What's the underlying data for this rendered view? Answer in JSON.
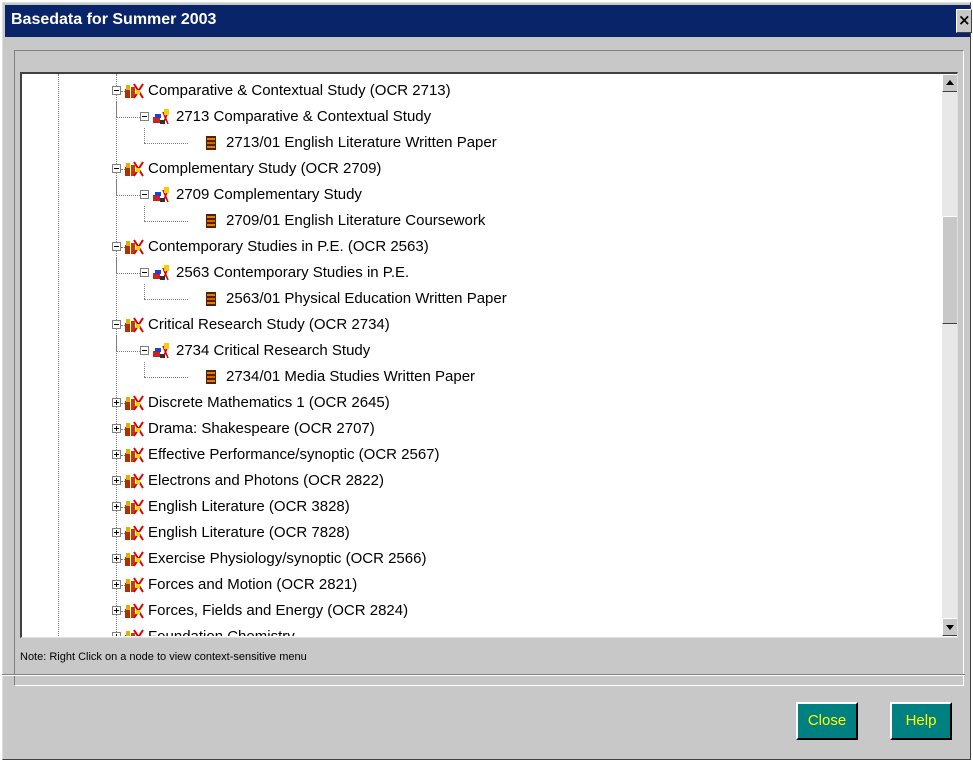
{
  "window": {
    "title": "Basedata for Summer 2003",
    "close_glyph": "×"
  },
  "tree": {
    "rows": [
      {
        "label": "Comparative & Contextual Study (OCR 2713)",
        "level": 0,
        "icon": "subject-icon",
        "expander": "minus"
      },
      {
        "label": "2713 Comparative & Contextual Study",
        "level": 1,
        "icon": "unit-icon",
        "expander": "minus"
      },
      {
        "label": "2713/01 English Literature Written Paper",
        "level": 2,
        "icon": "component-icon",
        "expander": "none"
      },
      {
        "label": "Complementary Study (OCR 2709)",
        "level": 0,
        "icon": "subject-icon",
        "expander": "minus"
      },
      {
        "label": "2709 Complementary Study",
        "level": 1,
        "icon": "unit-icon",
        "expander": "minus"
      },
      {
        "label": "2709/01 English Literature Coursework",
        "level": 2,
        "icon": "component-icon",
        "expander": "none"
      },
      {
        "label": "Contemporary Studies in P.E.  (OCR 2563)",
        "level": 0,
        "icon": "subject-icon",
        "expander": "minus"
      },
      {
        "label": "2563 Contemporary Studies in P.E.",
        "level": 1,
        "icon": "unit-icon",
        "expander": "minus"
      },
      {
        "label": "2563/01 Physical Education Written Paper",
        "level": 2,
        "icon": "component-icon",
        "expander": "none"
      },
      {
        "label": "Critical Research Study (OCR 2734)",
        "level": 0,
        "icon": "subject-icon",
        "expander": "minus"
      },
      {
        "label": "2734 Critical Research Study",
        "level": 1,
        "icon": "unit-icon",
        "expander": "minus"
      },
      {
        "label": "2734/01 Media Studies Written Paper",
        "level": 2,
        "icon": "component-icon",
        "expander": "none"
      },
      {
        "label": "Discrete Mathematics 1 (OCR 2645)",
        "level": 0,
        "icon": "subject-icon",
        "expander": "plus"
      },
      {
        "label": "Drama:  Shakespeare (OCR 2707)",
        "level": 0,
        "icon": "subject-icon",
        "expander": "plus"
      },
      {
        "label": "Effective Performance/synoptic (OCR 2567)",
        "level": 0,
        "icon": "subject-icon",
        "expander": "plus"
      },
      {
        "label": "Electrons and Photons (OCR 2822)",
        "level": 0,
        "icon": "subject-icon",
        "expander": "plus"
      },
      {
        "label": "English Literature (OCR 3828)",
        "level": 0,
        "icon": "subject-icon",
        "expander": "plus"
      },
      {
        "label": "English Literature (OCR 7828)",
        "level": 0,
        "icon": "subject-icon",
        "expander": "plus"
      },
      {
        "label": "Exercise Physiology/synoptic (OCR 2566)",
        "level": 0,
        "icon": "subject-icon",
        "expander": "plus"
      },
      {
        "label": "Forces and Motion (OCR 2821)",
        "level": 0,
        "icon": "subject-icon",
        "expander": "plus"
      },
      {
        "label": "Forces,  Fields and Energy (OCR 2824)",
        "level": 0,
        "icon": "subject-icon",
        "expander": "plus"
      },
      {
        "label": "Foundation Chemistry",
        "level": 0,
        "icon": "subject-icon",
        "expander": "plus"
      }
    ]
  },
  "scrollbar": {
    "up_arrow": "▲",
    "down_arrow": "▼"
  },
  "note": "Note: Right Click on a node to view context-sensitive menu",
  "buttons": {
    "close_label": "Close",
    "help_label": "Help"
  },
  "colors": {
    "title_bar": "#0a246a",
    "button_bg": "#008080",
    "button_text": "#ffff00",
    "dialog_bg": "#c8c8c8"
  }
}
